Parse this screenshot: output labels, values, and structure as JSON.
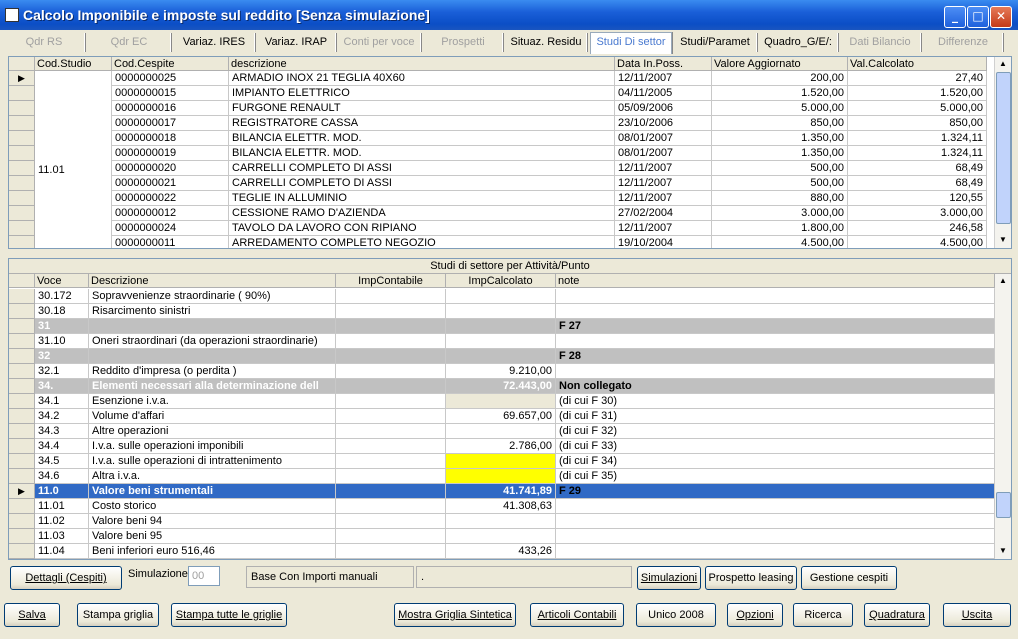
{
  "window": {
    "title": "Calcolo Imponibile e imposte sul reddito [Senza simulazione]"
  },
  "tabs": [
    {
      "label": "Qdr RS",
      "state": "disabled"
    },
    {
      "label": "Qdr EC",
      "state": "disabled"
    },
    {
      "label": "Variaz. IRES",
      "state": "normal"
    },
    {
      "label": "Variaz. IRAP",
      "state": "normal"
    },
    {
      "label": "Conti per voce",
      "state": "disabled"
    },
    {
      "label": "Prospetti",
      "state": "disabled"
    },
    {
      "label": "Situaz. Residu",
      "state": "normal"
    },
    {
      "label": "Studi Di settor",
      "state": "active"
    },
    {
      "label": "Studi/Paramet",
      "state": "normal"
    },
    {
      "label": "Quadro_G/E/:",
      "state": "normal"
    },
    {
      "label": "Dati Bilancio",
      "state": "disabled"
    },
    {
      "label": "Differenze",
      "state": "disabled"
    }
  ],
  "cespiti": {
    "columns": [
      "Cod.Studio",
      "Cod.Cespite",
      "descrizione",
      "Data In.Poss.",
      "Valore Aggiornato",
      "Val.Calcolato"
    ],
    "group_code": "11.01",
    "rows": [
      [
        "0000000025",
        "ARMADIO INOX 21 TEGLIA 40X60",
        "12/11/2007",
        "200,00",
        "27,40"
      ],
      [
        "0000000015",
        "IMPIANTO ELETTRICO",
        "04/11/2005",
        "1.520,00",
        "1.520,00"
      ],
      [
        "0000000016",
        "FURGONE RENAULT",
        "05/09/2006",
        "5.000,00",
        "5.000,00"
      ],
      [
        "0000000017",
        "REGISTRATORE CASSA",
        "23/10/2006",
        "850,00",
        "850,00"
      ],
      [
        "0000000018",
        "BILANCIA ELETTR. MOD.",
        "08/01/2007",
        "1.350,00",
        "1.324,11"
      ],
      [
        "0000000019",
        "BILANCIA ELETTR. MOD.",
        "08/01/2007",
        "1.350,00",
        "1.324,11"
      ],
      [
        "0000000020",
        "CARRELLI COMPLETO DI ASSI",
        "12/11/2007",
        "500,00",
        "68,49"
      ],
      [
        "0000000021",
        "CARRELLI COMPLETO DI ASSI",
        "12/11/2007",
        "500,00",
        "68,49"
      ],
      [
        "0000000022",
        "TEGLIE IN ALLUMINIO",
        "12/11/2007",
        "880,00",
        "120,55"
      ],
      [
        "0000000012",
        "CESSIONE RAMO D'AZIENDA",
        "27/02/2004",
        "3.000,00",
        "3.000,00"
      ],
      [
        "0000000024",
        "TAVOLO DA LAVORO CON RIPIANO",
        "12/11/2007",
        "1.800,00",
        "246,58"
      ],
      [
        "0000000011",
        "ARREDAMENTO COMPLETO NEGOZIO",
        "19/10/2004",
        "4.500,00",
        "4.500,00"
      ]
    ]
  },
  "studi": {
    "caption": "Studi di settore per  Attività/Punto",
    "columns": [
      "Voce",
      "Descrizione",
      "ImpContabile",
      "ImpCalcolato",
      "note"
    ],
    "rows": [
      {
        "voce": "30.172",
        "desc": "Sopravvenienze  straordinarie ( 90%)",
        "cont": "",
        "calc": "",
        "note": "",
        "style": "normal"
      },
      {
        "voce": "30.18",
        "desc": "Risarcimento sinistri",
        "cont": "",
        "calc": "",
        "note": "",
        "style": "normal"
      },
      {
        "voce": "31",
        "desc": "",
        "cont": "",
        "calc": "",
        "note": "F 27",
        "style": "group"
      },
      {
        "voce": "31.10",
        "desc": "Oneri straordinari (da operazioni straordinarie)",
        "cont": "",
        "calc": "",
        "note": "",
        "style": "normal"
      },
      {
        "voce": "32",
        "desc": "",
        "cont": "",
        "calc": "",
        "note": "F 28",
        "style": "group"
      },
      {
        "voce": "32.1",
        "desc": "Reddito d'impresa (o perdita )",
        "cont": "",
        "calc": "9.210,00",
        "note": "",
        "style": "normal"
      },
      {
        "voce": "34.",
        "desc": "Elementi necessari alla determinazione dell",
        "cont": "",
        "calc": "72.443,00",
        "note": "Non collegato",
        "style": "group"
      },
      {
        "voce": "34.1",
        "desc": "Esenzione i.v.a.",
        "cont": "",
        "calc": "",
        "note": " (di cui F 30)",
        "style": "beige"
      },
      {
        "voce": "34.2",
        "desc": "Volume d'affari",
        "cont": "",
        "calc": "69.657,00",
        "note": " (di cui F 31)",
        "style": "normal"
      },
      {
        "voce": "34.3",
        "desc": "Altre operazioni",
        "cont": "",
        "calc": "",
        "note": " (di cui F 32)",
        "style": "normal"
      },
      {
        "voce": "34.4",
        "desc": "I.v.a. sulle operazioni imponibili",
        "cont": "",
        "calc": "2.786,00",
        "note": " (di cui F 33)",
        "style": "normal"
      },
      {
        "voce": "34.5",
        "desc": "I.v.a. sulle operazioni di intrattenimento",
        "cont": "",
        "calc": "",
        "note": " (di cui F 34)",
        "style": "yellow"
      },
      {
        "voce": "34.6",
        "desc": "Altra i.v.a.",
        "cont": "",
        "calc": "",
        "note": " (di cui F 35)",
        "style": "yellow"
      },
      {
        "voce": "11.0",
        "desc": "Valore beni strumentali",
        "cont": "",
        "calc": "41.741,89",
        "note": "F 29",
        "style": "selected"
      },
      {
        "voce": "11.01",
        "desc": "Costo storico",
        "cont": "",
        "calc": "41.308,63",
        "note": "",
        "style": "normal"
      },
      {
        "voce": "11.02",
        "desc": "Valore beni 94",
        "cont": "",
        "calc": "",
        "note": "",
        "style": "normal"
      },
      {
        "voce": "11.03",
        "desc": "Valore beni 95",
        "cont": "",
        "calc": "",
        "note": "",
        "style": "normal"
      },
      {
        "voce": "11.04",
        "desc": "Beni inferiori euro 516,46",
        "cont": "",
        "calc": "433,26",
        "note": "",
        "style": "normal"
      }
    ]
  },
  "middle": {
    "dettagli": "Dettagli (Cespiti)",
    "sim_label": "Simulazione",
    "sim_value": "00",
    "info": "Base Con Importi manuali",
    "info2": ".",
    "simulazioni": "Simulazioni",
    "prospetto": "Prospetto leasing",
    "gestione": "Gestione cespiti"
  },
  "bottom": {
    "salva": "Salva",
    "stampa_griglia": "Stampa griglia",
    "stampa_tutte": "Stampa tutte le griglie",
    "mostra": "Mostra Griglia Sintetica",
    "articoli": "Articoli Contabili",
    "unico": "Unico 2008",
    "opzioni": "Opzioni",
    "ricerca": "Ricerca",
    "quadratura": "Quadratura",
    "uscita": "Uscita"
  },
  "colors": {
    "titlebar": "#0b4ec6",
    "selected_row": "#316ac5",
    "group_row": "#c0c0c0",
    "yellow": "#ffff00",
    "face": "#ece9d8"
  }
}
